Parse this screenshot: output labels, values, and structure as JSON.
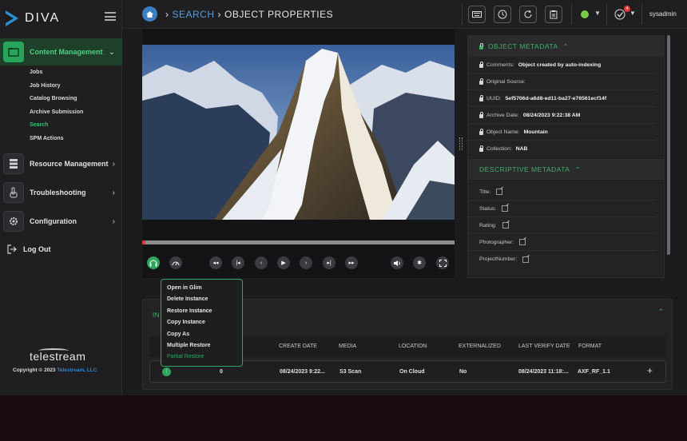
{
  "app": {
    "title": "DIVA"
  },
  "sidebar": {
    "active": {
      "label": "Content Management",
      "icon": "folder-icon"
    },
    "subitems": [
      "Jobs",
      "Job History",
      "Catalog Browsing",
      "Archive Submission",
      "Search",
      "SPM Actions"
    ],
    "active_subitem": "Search",
    "items": [
      {
        "label": "Resource Management",
        "icon": "server-icon"
      },
      {
        "label": "Troubleshooting",
        "icon": "hand-pointer-icon"
      },
      {
        "label": "Configuration",
        "icon": "gear-icon"
      }
    ],
    "logout": "Log Out",
    "brand": "telestream",
    "copyright": "Copyright © 2023",
    "copyright_link": "Telestream, LLC"
  },
  "header": {
    "breadcrumb": [
      "SEARCH",
      "OBJECT PROPERTIES"
    ],
    "notification_count": "4",
    "user": "sysadmin",
    "status_color": "#7ac943"
  },
  "object_metadata": {
    "title": "OBJECT METADATA",
    "rows": [
      {
        "label": "Comments:",
        "value": "Object created by auto-indexing"
      },
      {
        "label": "Original Source:",
        "value": ""
      },
      {
        "label": "UUID:",
        "value": "5ef5706d-a6d8-ed11-ba27-e76561ecf14f"
      },
      {
        "label": "Archive Date:",
        "value": "08/24/2023 9:22:38 AM"
      },
      {
        "label": "Object Name:",
        "value": "Mountain"
      },
      {
        "label": "Collection:",
        "value": "NAB"
      }
    ]
  },
  "descriptive_metadata": {
    "title": "DESCRIPTIVE METADATA",
    "fields": [
      "Title:",
      "Status:",
      "Rating:",
      "Photographer:",
      "ProjectNumber:"
    ]
  },
  "instances": {
    "title": "IN",
    "columns": [
      "CREATE DATE",
      "MEDIA",
      "LOCATION",
      "EXTERNALIZED",
      "LAST VERIFY DATE",
      "FORMAT"
    ],
    "row": {
      "id": "0",
      "create_date": "08/24/2023 9:22...",
      "media": "S3 Scan",
      "location": "On Cloud",
      "externalized": "No",
      "last_verify_date": "08/24/2023 11:18:...",
      "format": "AXF_RF_1.1"
    }
  },
  "context_menu": {
    "items": [
      "Open in Glim",
      "Delete Instance",
      "Restore Instance",
      "Copy Instance",
      "Copy As",
      "Multiple Restore"
    ],
    "disabled_item": "Partial Restore"
  },
  "player": {
    "progress_percent": 1
  }
}
